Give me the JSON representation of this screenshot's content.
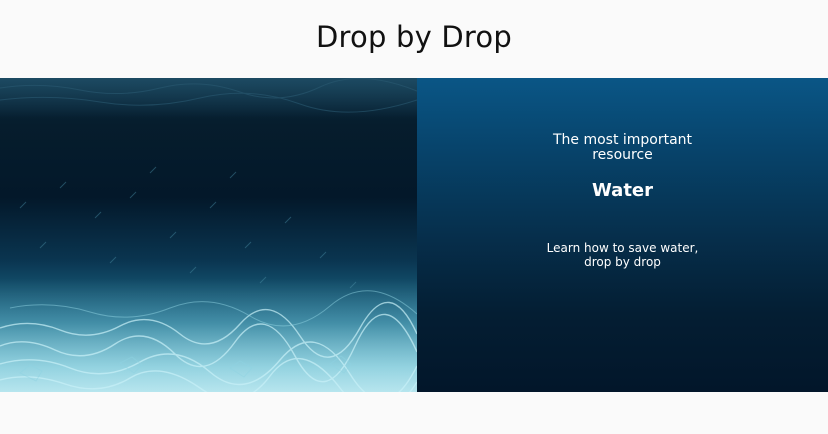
{
  "header": {
    "title": "Drop by Drop"
  },
  "hero": {
    "image_subject": "underwater-ocean-floor",
    "panel": {
      "tagline_line1": "The most important",
      "tagline_line2": "resource",
      "resource": "Water",
      "cta_line1": "Learn how to save water,",
      "cta_line2": "drop by drop"
    }
  },
  "colors": {
    "page_background": "#fafafa",
    "title_text": "#111111",
    "panel_top": "#0a5686",
    "panel_bottom": "#02162a",
    "panel_text": "#ffffff"
  }
}
